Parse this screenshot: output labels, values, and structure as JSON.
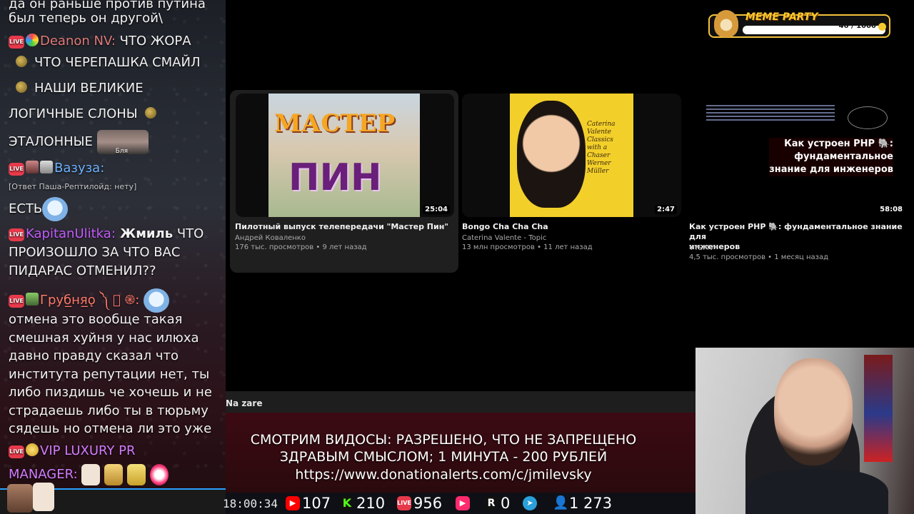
{
  "chat": {
    "lines": [
      {
        "text": "да он раньше против путина"
      },
      {
        "text": "был теперь он другой\\"
      },
      {
        "user": "Deanon NV:",
        "text": " ЧТО ЖОРА",
        "user_color": "#e07a7a"
      },
      {
        "text": "ЧТО ЧЕРЕПАШКА СМАЙЛ"
      },
      {
        "text": "НАШИ ВЕЛИКИЕ"
      },
      {
        "text": "ЛОГИЧНЫЕ СЛОНЫ"
      },
      {
        "text": "ЭТАЛОННЫЕ"
      },
      {
        "user": "Вазуза:",
        "user_color": "#6fb3ff"
      },
      {
        "text": "[Ответ Паша-Рептилойд: нету]"
      },
      {
        "text": "ЕСТЬ"
      },
      {
        "user": "KapitanUlitka:",
        "mention": " Жмиль",
        "text": " ЧТО",
        "user_color": "#c45cff"
      },
      {
        "text": "ПРОИЗОШЛО ЗА ЧТО ВАС"
      },
      {
        "text": "ПИДАРАС ОТМЕНИЛ??"
      },
      {
        "user": "Груб̲ня̲ǫ ༽ ⃕ ֎:",
        "user_color": "#ff7a6b"
      },
      {
        "text": " отмена это вообще такая"
      },
      {
        "text": "смешная хуйня у нас илюха"
      },
      {
        "text": "давно правду сказал что"
      },
      {
        "text": "института репутации нет, ты"
      },
      {
        "text": "либо пиздишь че хочешь и не"
      },
      {
        "text": "страдаешь либо ты в тюрьму"
      },
      {
        "text": "сядешь но отмена ли это уже"
      },
      {
        "user": "VIP LUXURY PR",
        "user_color": "#d27cff"
      },
      {
        "user": "MANAGER:",
        "user_color": "#d27cff"
      }
    ],
    "emote_caption": "Бля"
  },
  "videos": [
    {
      "title": "Пилотный выпуск телепередачи \"Мастер Пин\"",
      "channel": "Андрей Коваленко",
      "stats": "176 тыс. просмотров • 9 лет назад",
      "duration": "25:04",
      "thumb_text_top": "МАСТЕР",
      "thumb_text_bottom": "ПИН"
    },
    {
      "title": "Bongo Cha Cha Cha",
      "channel": "Caterina Valente - Topic",
      "stats": "13 млн просмотров • 11 лет назад",
      "duration": "2:47",
      "thumb_text": "Caterina Valente Classics with a Chaser Werner Müller"
    },
    {
      "title_line1": "Как устроен PHP 🐘: фундаментальное знание для",
      "title_line2": "инженеров",
      "channel": "VYSMV",
      "stats": "4,5 тыс. просмотров • 1 месяц назад",
      "duration": "58:08",
      "thumb_line1": "Как устроен PHP 🐘:",
      "thumb_line2": "фундаментальное",
      "thumb_line3": "знание для инженеров"
    }
  ],
  "meme_party": {
    "title": "MEME PARTY",
    "progress": "40 / 1000",
    "progress_fraction": 0.04
  },
  "ticker": {
    "label": "Na zare",
    "promo_line1": "СМОТРИМ ВИДОСЫ: РАЗРЕШЕНО, ЧТО НЕ ЗАПРЕЩЕНО",
    "promo_line2": "ЗДРАВЫМ СМЫСЛОМ; 1 МИНУТА - 200 РУБЛЕЙ",
    "promo_line3": "https://www.donationalerts.com/c/jmilevsky"
  },
  "stats": {
    "time": "18:00:34",
    "youtube": "107",
    "kick": "210",
    "live": "956",
    "vkplay": "",
    "rutube": "0",
    "telegram": "",
    "viewers": "1 273",
    "colors": {
      "youtube": "#ff0000",
      "kick": "#53fc18",
      "live": "#e63a4b",
      "vkplay": "#ff2a6d",
      "telegram": "#2aa1da",
      "viewers": "#3ea6ff"
    }
  }
}
